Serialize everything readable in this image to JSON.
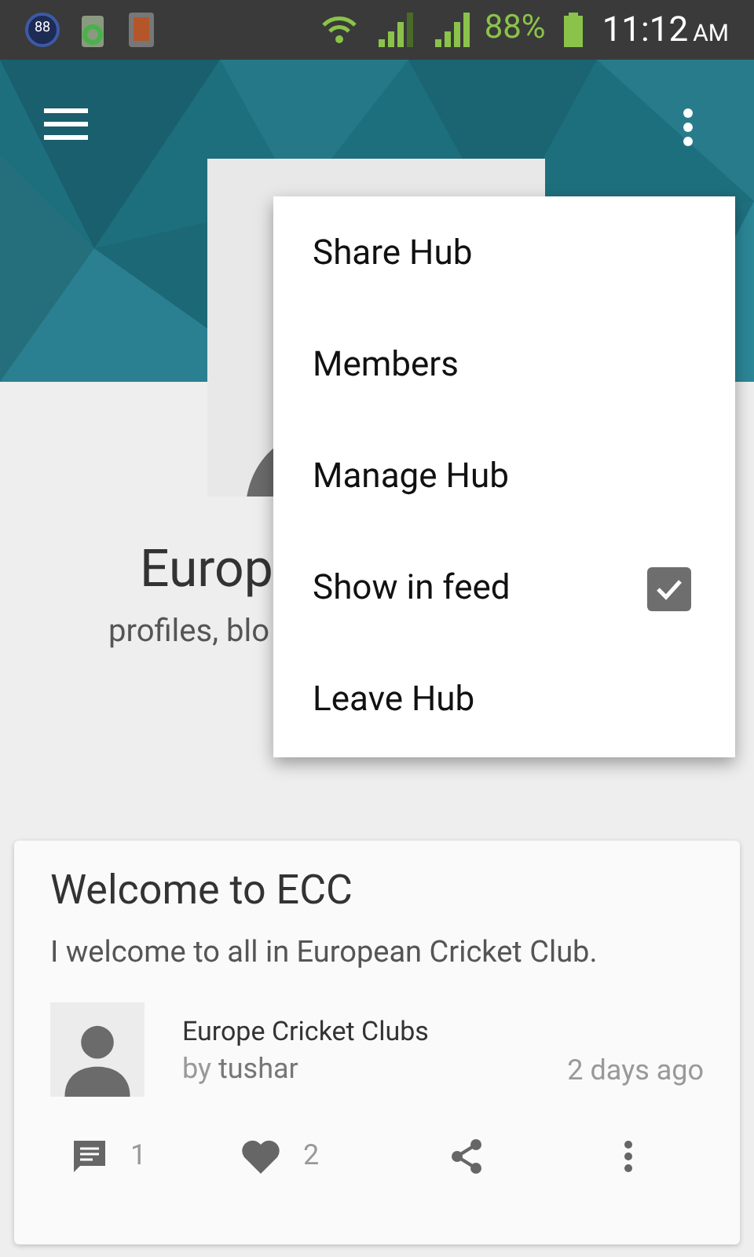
{
  "status_bar": {
    "notification_badge": "88",
    "battery": "88%",
    "time": "11:12",
    "meridiem": "AM"
  },
  "hub": {
    "title": "Europ",
    "description": "profiles, blo"
  },
  "menu": {
    "items": [
      {
        "label": "Share Hub",
        "kind": "plain"
      },
      {
        "label": "Members",
        "kind": "plain"
      },
      {
        "label": "Manage Hub",
        "kind": "plain"
      },
      {
        "label": "Show in feed",
        "kind": "checkbox",
        "checked": true
      },
      {
        "label": "Leave Hub",
        "kind": "plain"
      }
    ]
  },
  "post": {
    "title": "Welcome to ECC",
    "body": "I welcome to all in European Cricket Club.",
    "group": "Europe Cricket Clubs",
    "by": "by",
    "author": "tushar",
    "time": "2 days ago",
    "comments": "1",
    "likes": "2"
  }
}
